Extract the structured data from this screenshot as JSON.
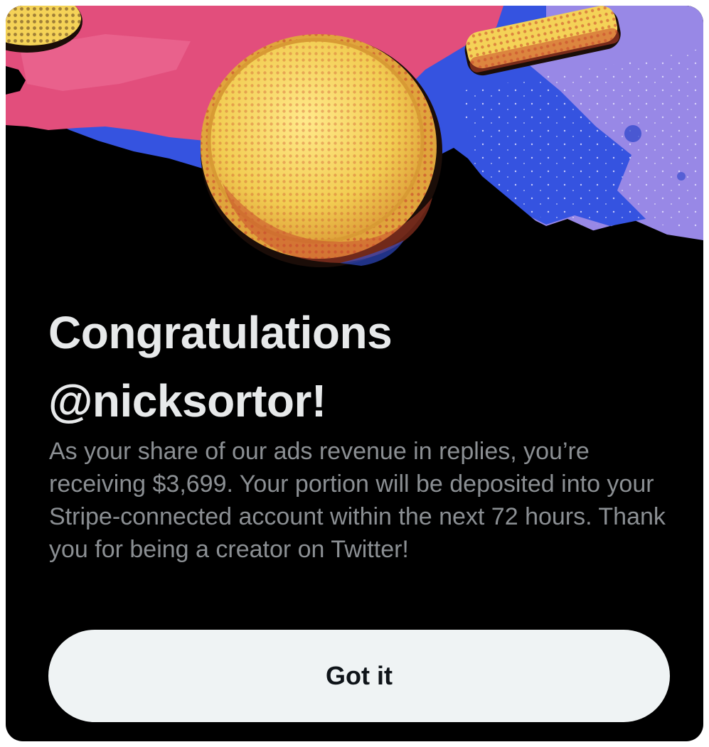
{
  "dialog": {
    "title_line1": "Congratulations",
    "title_line2": "@nicksortor!",
    "message": "As your share of our ads revenue in replies, you’re receiving $3,699. Your portion will be deposited into your Stripe-connected account within the next 72 hours. Thank you for being a creator on Twitter!",
    "button_label": "Got it"
  },
  "colors": {
    "background": "#000000",
    "title": "#e7e9ea",
    "message": "#8b8f93",
    "button_bg": "#eff3f4",
    "button_text": "#0f1419",
    "art_pink": "#e4507e",
    "art_blue": "#3b58e6",
    "art_lavender": "#9b8de8",
    "coin_yellow": "#f4d257"
  },
  "icons": {
    "hero": "coins-illustration"
  }
}
